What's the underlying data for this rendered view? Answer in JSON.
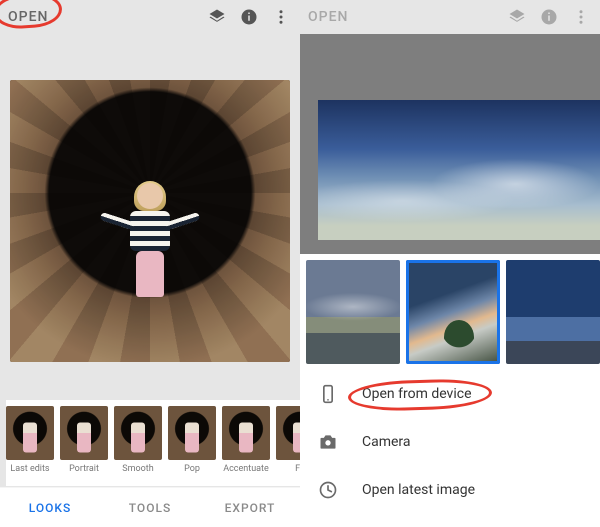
{
  "left": {
    "topbar": {
      "open_label": "OPEN"
    },
    "filters": [
      {
        "label": "Last edits"
      },
      {
        "label": "Portrait"
      },
      {
        "label": "Smooth"
      },
      {
        "label": "Pop"
      },
      {
        "label": "Accentuate"
      },
      {
        "label": "Fa"
      }
    ],
    "tabs": {
      "looks": "LOOKS",
      "tools": "TOOLS",
      "export": "EXPORT"
    }
  },
  "right": {
    "topbar": {
      "open_label": "OPEN"
    },
    "sheet": {
      "open_from_device": "Open from device",
      "camera": "Camera",
      "open_latest": "Open latest image"
    }
  }
}
